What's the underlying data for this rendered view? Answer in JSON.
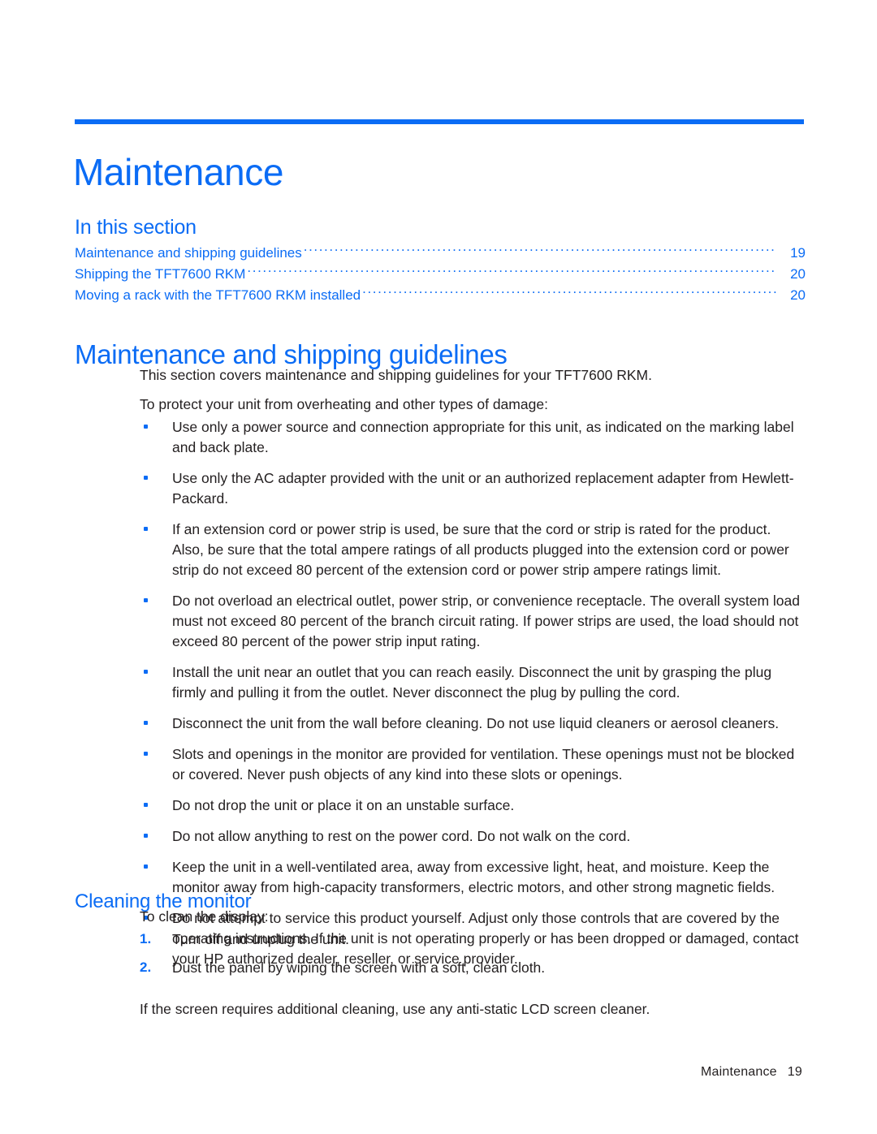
{
  "document": {
    "chapter_title": "Maintenance"
  },
  "in_this_section": {
    "heading": "In this section",
    "entries": [
      {
        "label": "Maintenance and shipping guidelines",
        "page": "19"
      },
      {
        "label": "Shipping the TFT7600 RKM",
        "page": "20"
      },
      {
        "label": "Moving a rack with the TFT7600 RKM installed",
        "page": "20"
      }
    ]
  },
  "sections": {
    "maintenance_shipping": {
      "heading": "Maintenance and shipping guidelines",
      "intro_paragraph": "This section covers maintenance and shipping guidelines for your TFT7600 RKM.",
      "lead_in": "To protect your unit from overheating and other types of damage:",
      "bullets": [
        "Use only a power source and connection appropriate for this unit, as indicated on the marking label and back plate.",
        "Use only the AC adapter provided with the unit or an authorized replacement adapter from Hewlett-Packard.",
        "If an extension cord or power strip is used, be sure that the cord or strip is rated for the product. Also, be sure that the total ampere ratings of all products plugged into the extension cord or power strip do not exceed 80 percent of the extension cord or power strip ampere ratings limit.",
        "Do not overload an electrical outlet, power strip, or convenience receptacle. The overall system load must not exceed 80 percent of the branch circuit rating. If power strips are used, the load should not exceed 80 percent of the power strip input rating.",
        "Install the unit near an outlet that you can reach easily. Disconnect the unit by grasping the plug firmly and pulling it from the outlet. Never disconnect the plug by pulling the cord.",
        "Disconnect the unit from the wall before cleaning. Do not use liquid cleaners or aerosol cleaners.",
        "Slots and openings in the monitor are provided for ventilation. These openings must not be blocked or covered. Never push objects of any kind into these slots or openings.",
        "Do not drop the unit or place it on an unstable surface.",
        "Do not allow anything to rest on the power cord. Do not walk on the cord.",
        "Keep the unit in a well-ventilated area, away from excessive light, heat, and moisture. Keep the monitor away from high-capacity transformers, electric motors, and other strong magnetic fields.",
        "Do not attempt to service this product yourself. Adjust only those controls that are covered by the operating instructions. If the unit is not operating properly or has been dropped or damaged, contact your HP authorized dealer, reseller, or service provider."
      ]
    },
    "cleaning_monitor": {
      "heading": "Cleaning the monitor",
      "lead_in": "To clean the display:",
      "steps": [
        {
          "marker": "1.",
          "text": "Turn off and unplug the unit."
        },
        {
          "marker": "2.",
          "text": "Dust the panel by wiping the screen with a soft, clean cloth."
        }
      ],
      "closing_paragraph": "If the screen requires additional cleaning, use any anti-static LCD screen cleaner."
    }
  },
  "footer": {
    "label": "Maintenance",
    "page_number": "19"
  },
  "colors": {
    "accent_blue": "#0b6cf5",
    "body_text": "#231f20"
  }
}
